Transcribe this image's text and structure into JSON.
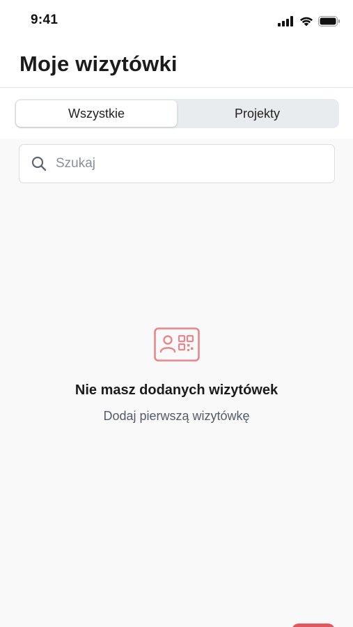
{
  "status_bar": {
    "time": "9:41"
  },
  "header": {
    "title": "Moje wizytówki"
  },
  "tabs": [
    {
      "label": "Wszystkie",
      "active": true
    },
    {
      "label": "Projekty",
      "active": false
    }
  ],
  "search": {
    "placeholder": "Szukaj",
    "value": ""
  },
  "empty_state": {
    "icon": "business-card-qr-icon",
    "title": "Nie masz dodanych wizytówek",
    "subtitle": "Dodaj pierwszą wizytówkę"
  },
  "colors": {
    "accent": "#e0575f",
    "icon_accent": "#e8868b",
    "background": "#f9f9f9",
    "segment_bg": "#e9ecef"
  }
}
